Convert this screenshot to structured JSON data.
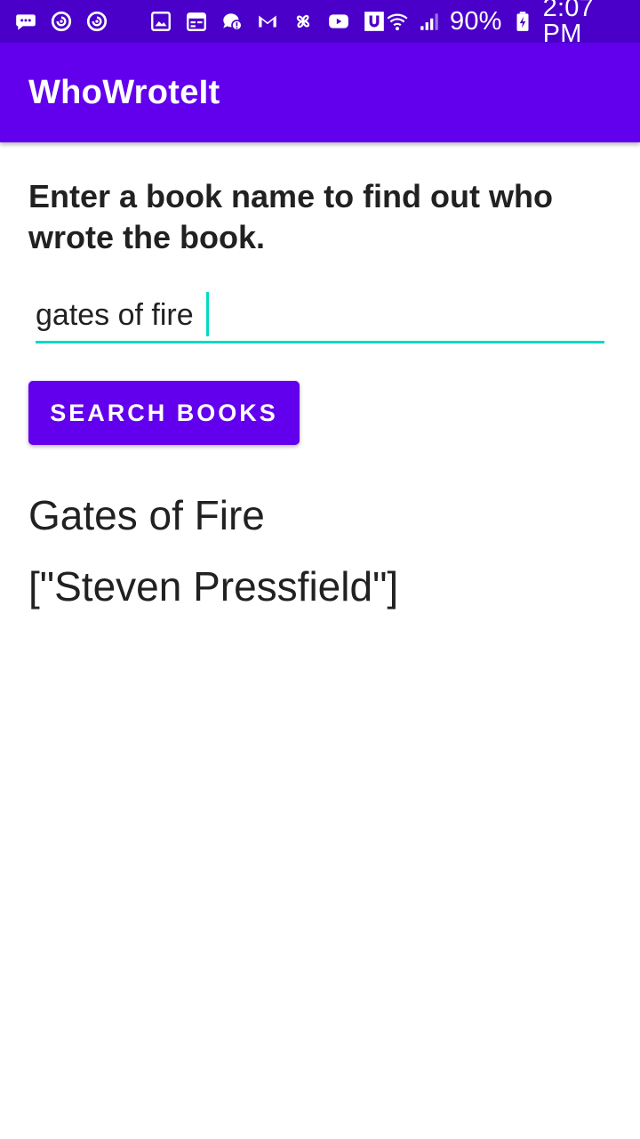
{
  "status_bar": {
    "battery": "90%",
    "time": "2:07 PM",
    "left_icons": [
      "messages-icon",
      "sync-icon",
      "sync-icon",
      "gallery-icon",
      "calendar-icon",
      "chat-alert-icon",
      "gmail-icon",
      "pinwheel-icon",
      "youtube-icon",
      "u-app-icon"
    ],
    "right_icons": [
      "wifi-icon",
      "cellular-signal-icon",
      "battery-charging-icon"
    ]
  },
  "app_bar": {
    "title": "WhoWroteIt",
    "color": "#6200ee"
  },
  "main": {
    "prompt": "Enter a book name to find out who wrote the book.",
    "search_input": {
      "value": "gates of fire",
      "placeholder": ""
    },
    "search_button_label": "SEARCH BOOKS",
    "result_title": "Gates of Fire",
    "result_author": "[\"Steven Pressfield\"]"
  },
  "colors": {
    "status_bar": "#4a00c8",
    "accent": "#03dac5",
    "primary": "#6200ee",
    "text": "#212121"
  }
}
